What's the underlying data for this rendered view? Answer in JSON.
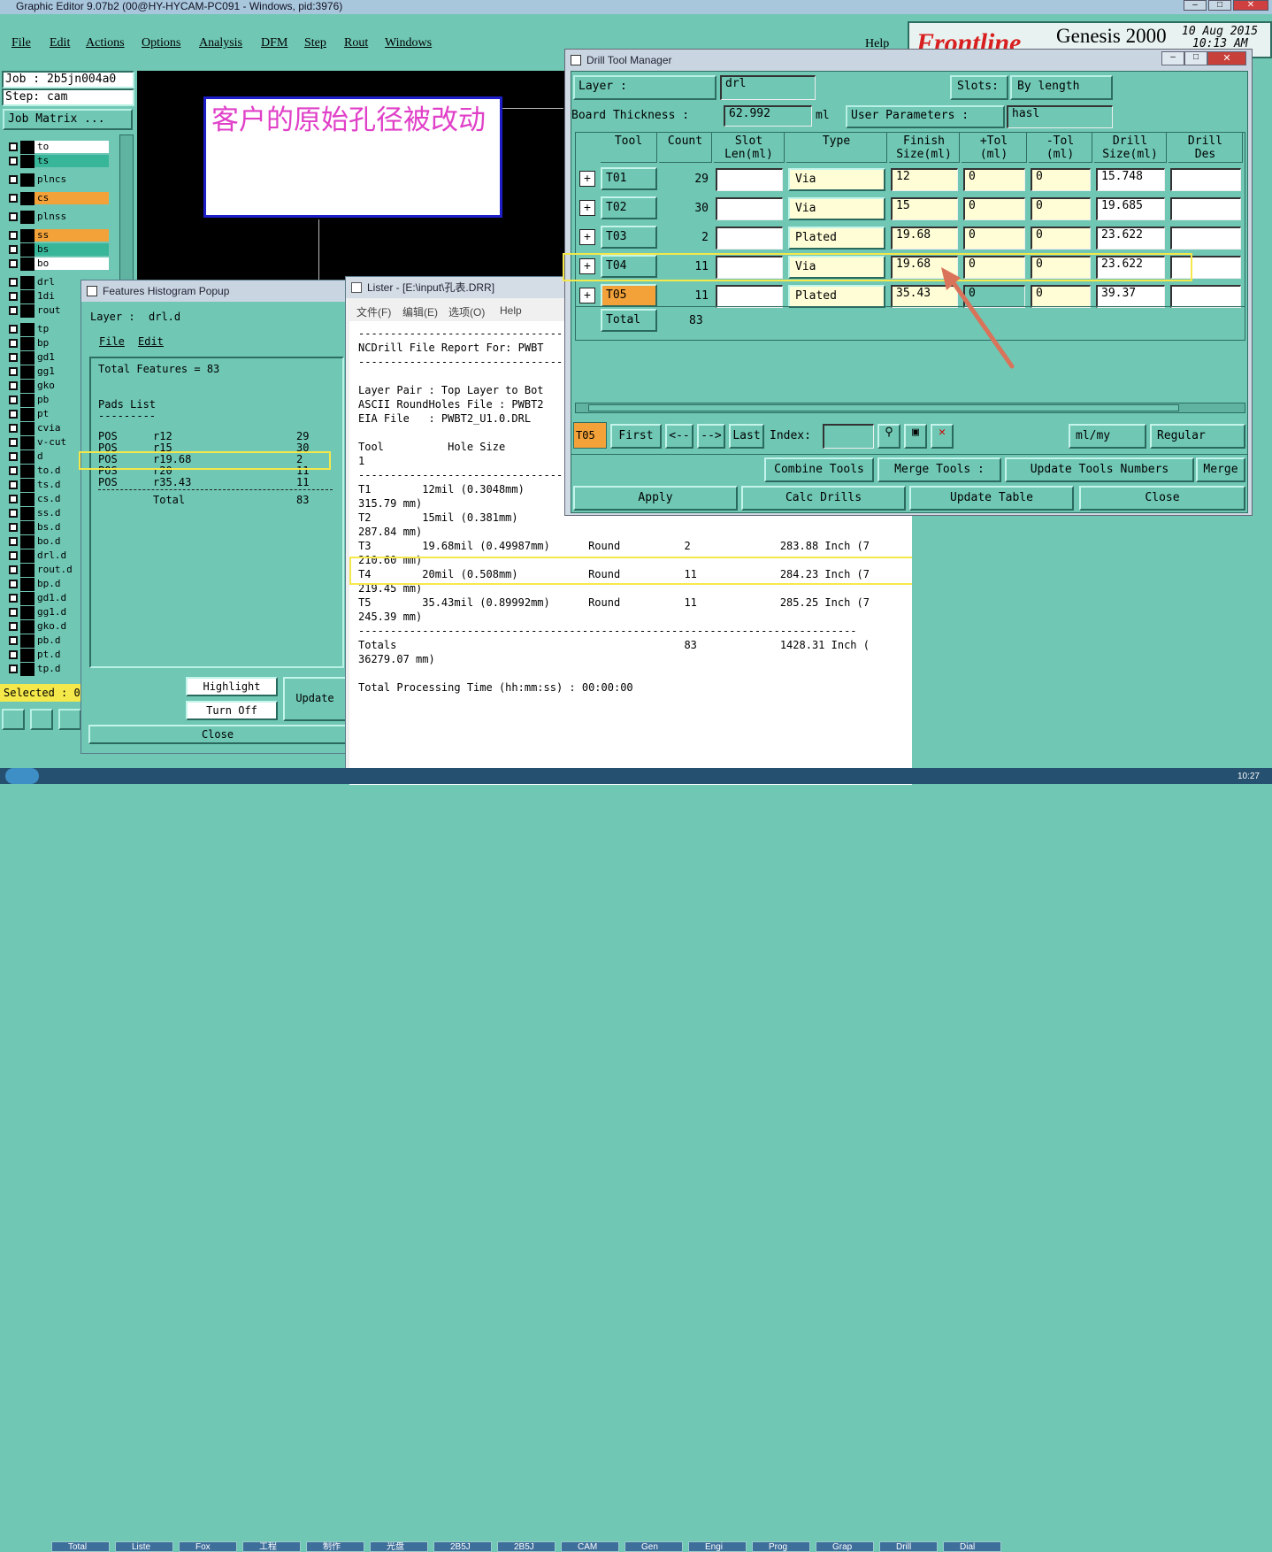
{
  "window": {
    "title": "Graphic Editor 9.07b2 (00@HY-HYCAM-PC091 - Windows, pid:3976)"
  },
  "menu": [
    "File",
    "Edit",
    "Actions",
    "Options",
    "Analysis",
    "DFM",
    "Step",
    "Rout",
    "Windows"
  ],
  "help": "Help",
  "brand": {
    "logo": "Frontline",
    "product": "Genesis 2000",
    "date": "10 Aug 2015",
    "time": "10:13 AM"
  },
  "job": {
    "job_label": "Job : 2b5jn004a0",
    "step_label": "Step: cam",
    "matrix_button": "Job Matrix ..."
  },
  "layers": [
    "to",
    "ts",
    "plncs",
    "cs",
    "plnss",
    "ss",
    "bs",
    "bo",
    "drl",
    "1di",
    "rout",
    "tp",
    "bp",
    "gd1",
    "gg1",
    "gko",
    "pb",
    "pt",
    "cvia",
    "v-cut",
    "d",
    "to.d",
    "ts.d",
    "cs.d",
    "ss.d",
    "bs.d",
    "bo.d",
    "drl.d",
    "rout.d",
    "bp.d",
    "gd1.d",
    "gg1.d",
    "gko.d",
    "pb.d",
    "pt.d",
    "tp.d"
  ],
  "selected_label": "Selected : 0",
  "annotation": "客户的原始孔径被改动",
  "histogram": {
    "title": "Features Histogram Popup",
    "layer_label": "Layer :",
    "layer_value": "drl.d",
    "menu": [
      "File",
      "Edit"
    ],
    "total_features": "Total Features = 83",
    "pads_list": "Pads List",
    "divider": "---------",
    "rows": [
      {
        "type": "POS",
        "sym": "r12",
        "count": "29"
      },
      {
        "type": "POS",
        "sym": "r15",
        "count": "30"
      },
      {
        "type": "POS",
        "sym": "r19.68",
        "count": "2"
      },
      {
        "type": "POS",
        "sym": "r20",
        "count": "11"
      },
      {
        "type": "POS",
        "sym": "r35.43",
        "count": "11"
      }
    ],
    "total_label": "Total",
    "total_value": "83",
    "buttons": {
      "highlight": "Highlight",
      "turn_off": "Turn Off",
      "update": "Update",
      "close": "Close"
    }
  },
  "lister": {
    "title": "Lister - [E:\\input\\孔表.DRR]",
    "menu": [
      "文件(F)",
      "编辑(E)",
      "选项(O)",
      "Help"
    ],
    "lines": [
      "------------------------------------------------------------------------------",
      "NCDrill File Report For: PWBT",
      "------------------------------------------------------------------------------",
      "",
      "Layer Pair : Top Layer to Bot",
      "ASCII RoundHoles File : PWBT2",
      "EIA File   : PWBT2_U1.0.DRL",
      "",
      "Tool          Hole Size",
      "1",
      "------------------------------------------------------------------------------",
      "T1        12mil (0.3048mm)",
      "315.79 mm)",
      "T2        15mil (0.381mm)",
      "287.84 mm)",
      "T3        19.68mil (0.49987mm)      Round          2              283.88 Inch (7",
      "210.60 mm)",
      "T4        20mil (0.508mm)           Round          11             284.23 Inch (7",
      "219.45 mm)",
      "T5        35.43mil (0.89992mm)      Round          11             285.25 Inch (7",
      "245.39 mm)",
      "------------------------------------------------------------------------------",
      "Totals                                             83             1428.31 Inch (",
      "36279.07 mm)",
      "",
      "Total Processing Time (hh:mm:ss) : 00:00:00"
    ]
  },
  "drill": {
    "title": "Drill Tool Manager",
    "layer_label": "Layer             :",
    "layer_value": "drl",
    "slots_label": "Slots:",
    "slots_value": "By length",
    "thickness_label": "Board Thickness  :",
    "thickness_value": "62.992",
    "thickness_unit": "ml",
    "user_params_label": "User Parameters  :",
    "user_params_value": "hasl",
    "columns": [
      {
        "l1": "Tool",
        "l2": ""
      },
      {
        "l1": "Count",
        "l2": ""
      },
      {
        "l1": "Slot",
        "l2": "Len(ml)"
      },
      {
        "l1": "Type",
        "l2": ""
      },
      {
        "l1": "Finish",
        "l2": "Size(ml)"
      },
      {
        "l1": "+Tol",
        "l2": "(ml)"
      },
      {
        "l1": "-Tol",
        "l2": "(ml)"
      },
      {
        "l1": "Drill",
        "l2": "Size(ml)"
      },
      {
        "l1": "Drill",
        "l2": "Des"
      }
    ],
    "rows": [
      {
        "tool": "T01",
        "count": "29",
        "type": "Via",
        "finish": "12",
        "ptol": "0",
        "ntol": "0",
        "drill": "15.748"
      },
      {
        "tool": "T02",
        "count": "30",
        "type": "Via",
        "finish": "15",
        "ptol": "0",
        "ntol": "0",
        "drill": "19.685"
      },
      {
        "tool": "T03",
        "count": "2",
        "type": "Plated",
        "finish": "19.68",
        "ptol": "0",
        "ntol": "0",
        "drill": "23.622"
      },
      {
        "tool": "T04",
        "count": "11",
        "type": "Via",
        "finish": "19.68",
        "ptol": "0",
        "ntol": "0",
        "drill": "23.622"
      },
      {
        "tool": "T05",
        "count": "11",
        "type": "Plated",
        "finish": "35.43",
        "ptol": "0",
        "ntol": "0",
        "drill": "39.37"
      }
    ],
    "total_label": "Total",
    "total_count": "83",
    "nav": {
      "current": "T05",
      "first": "First",
      "prev": "<--",
      "next": "-->",
      "last": "Last",
      "index_label": "Index:",
      "units": "ml/my",
      "mode": "Regular"
    },
    "buttons": {
      "combine": "Combine Tools",
      "merge_tools": "Merge Tools :",
      "update_numbers": "Update Tools Numbers",
      "merge": "Merge",
      "apply": "Apply",
      "calc": "Calc Drills",
      "update_table": "Update Table",
      "close": "Close"
    }
  },
  "colors": {
    "teal": "#6fc7b4",
    "highlight": "#f4e84a",
    "orange": "#f3a23a",
    "arrow": "#d9735a",
    "annotation_text": "#e040c8"
  },
  "taskbar": [
    "Total",
    "Liste",
    "Fox",
    "工程",
    "制作",
    "光盘",
    "2B5J",
    "2B5J",
    "CAM",
    "Gen",
    "Engi",
    "Prog",
    "Grap",
    "Drill",
    "Dial"
  ],
  "clock": "10:27"
}
